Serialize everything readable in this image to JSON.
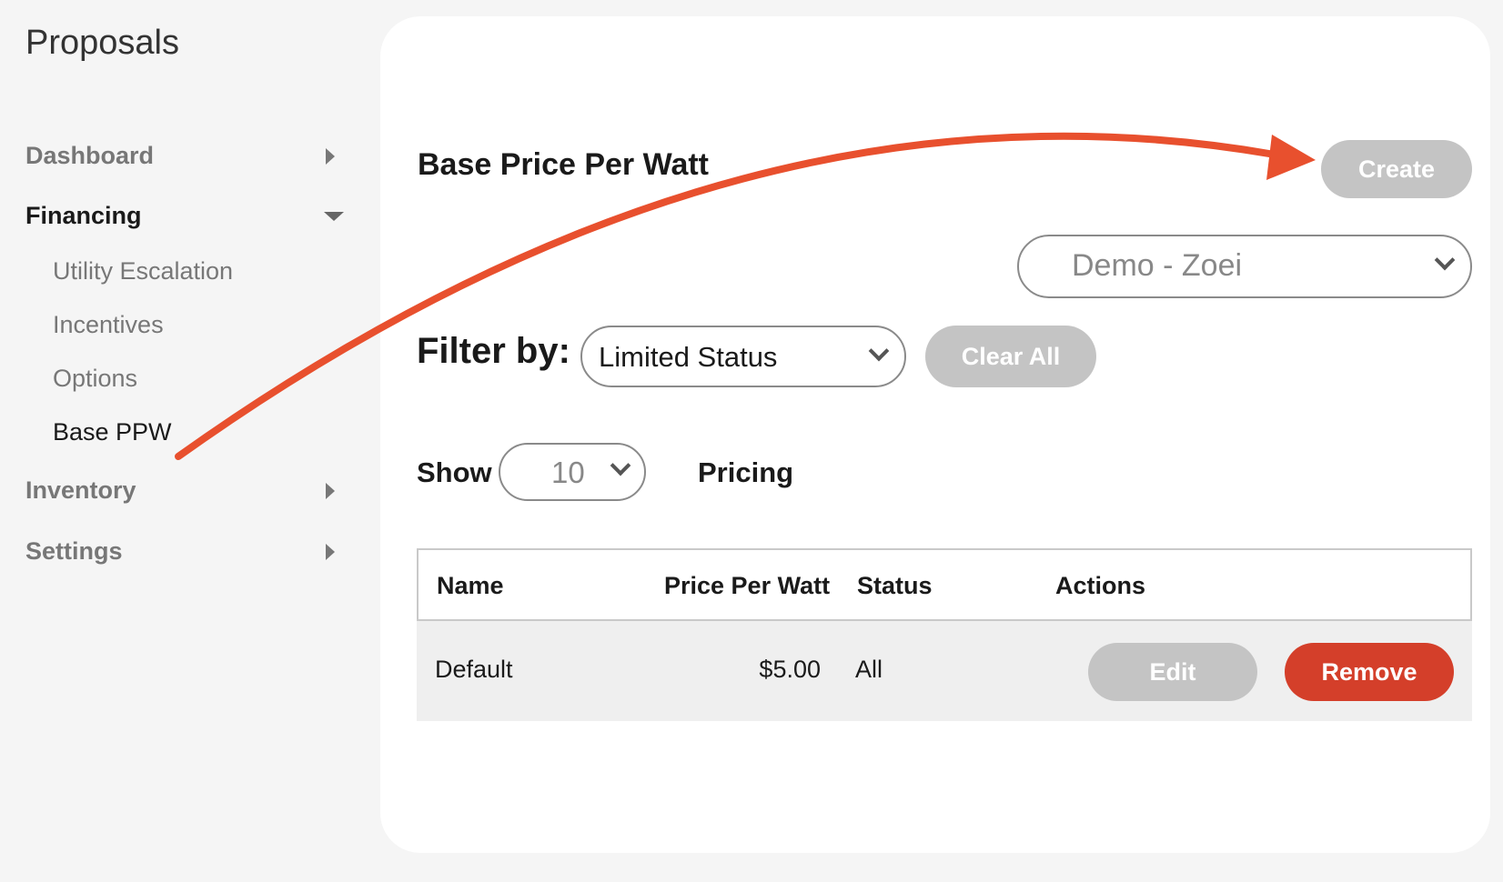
{
  "app": {
    "title": "Proposals"
  },
  "sidebar": {
    "items": [
      {
        "label": "Dashboard"
      },
      {
        "label": "Financing"
      },
      {
        "label": "Inventory"
      },
      {
        "label": "Settings"
      }
    ],
    "financing_sub": [
      {
        "label": "Utility Escalation"
      },
      {
        "label": "Incentives"
      },
      {
        "label": "Options"
      },
      {
        "label": "Base PPW"
      }
    ]
  },
  "main": {
    "title": "Base Price Per Watt",
    "create_label": "Create",
    "account_select": "Demo - Zoei",
    "filter_label": "Filter by:",
    "filter_select": "Limited Status",
    "clear_label": "Clear All",
    "show_label": "Show",
    "show_count": "10",
    "pricing_label": "Pricing"
  },
  "table": {
    "headers": [
      "Name",
      "Price Per Watt",
      "Status",
      "Actions"
    ],
    "rows": [
      {
        "name": "Default",
        "ppw": "$5.00",
        "status": "All",
        "edit": "Edit",
        "remove": "Remove"
      }
    ]
  },
  "colors": {
    "accent_red": "#d43f2a",
    "annotation_arrow": "#e8502e",
    "button_grey": "#c4c4c4"
  }
}
